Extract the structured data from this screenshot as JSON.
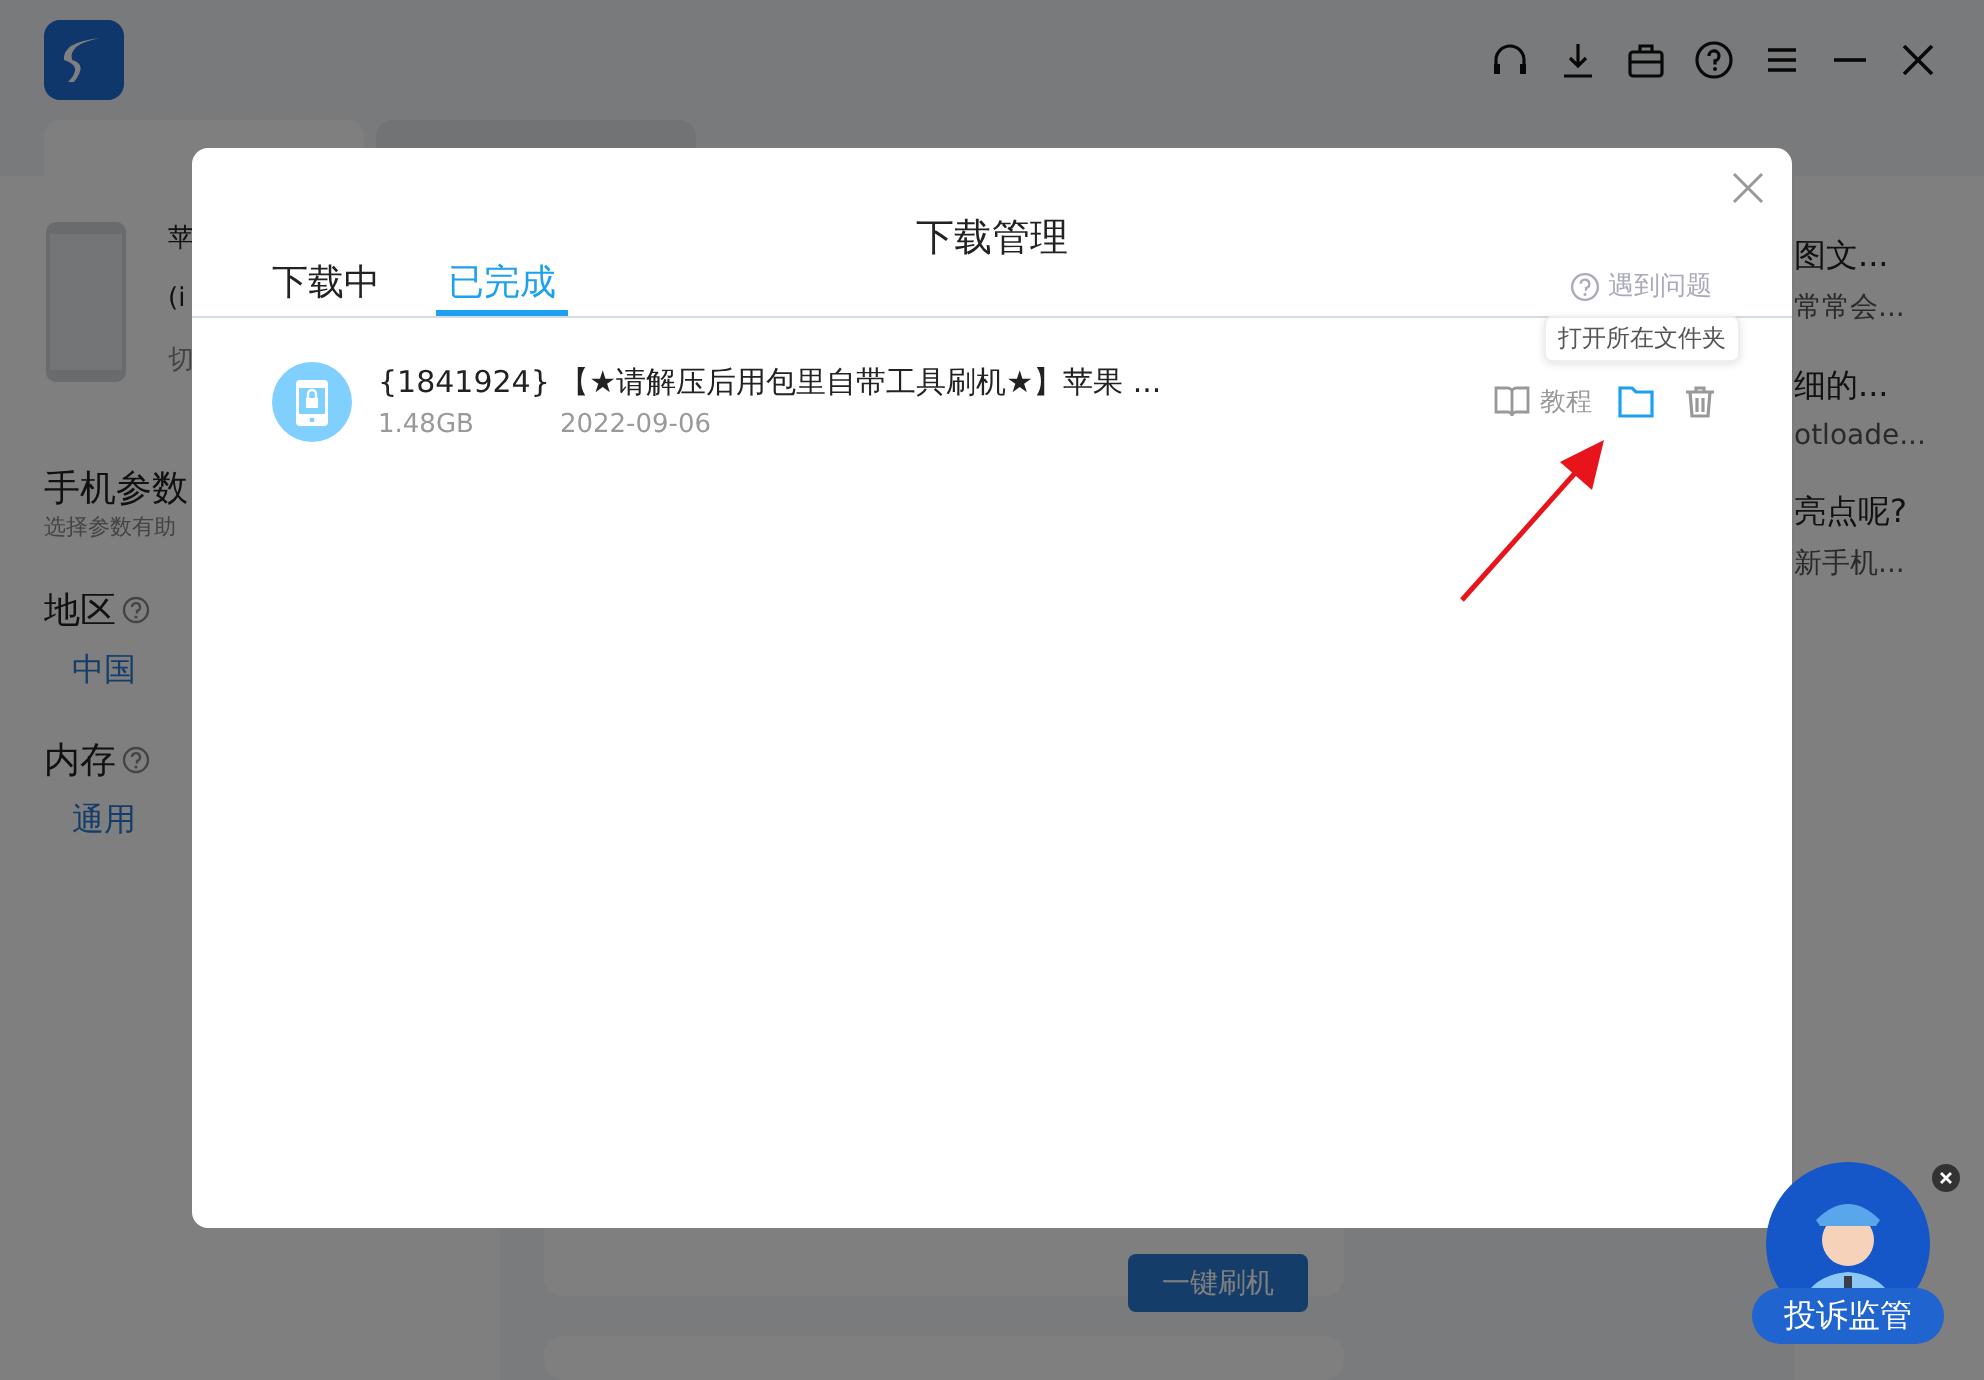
{
  "background": {
    "device_texts": [
      "苹",
      "(i",
      "切"
    ],
    "params": {
      "title": "手机参数",
      "subtitle": "选择参数有助",
      "fields": [
        {
          "label": "地区",
          "value": "中国"
        },
        {
          "label": "内存",
          "value": "通用"
        }
      ]
    },
    "articles": [
      {
        "title": "图文...",
        "summary": "常常会..."
      },
      {
        "title": "细的...",
        "summary": "otloade..."
      },
      {
        "title": "亮点呢?",
        "summary": "新手机..."
      }
    ],
    "flash_button": "一键刷机"
  },
  "dialog": {
    "title": "下载管理",
    "tabs": [
      {
        "label": "下载中",
        "selected": false
      },
      {
        "label": "已完成",
        "selected": true
      }
    ],
    "help_link": "遇到问题",
    "items": [
      {
        "name": "{1841924} 【★请解压后用包里自带工具刷机★】苹果 ...",
        "size": "1.48GB",
        "date": "2022-09-06",
        "tutorial": "教程",
        "tooltip": "打开所在文件夹"
      }
    ]
  },
  "complaint_widget": {
    "label": "投诉监管"
  }
}
